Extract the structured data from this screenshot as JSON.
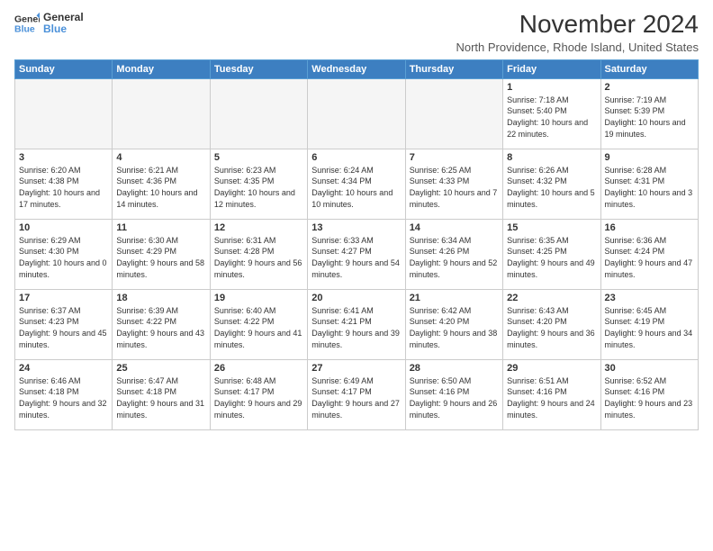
{
  "header": {
    "logo_line1": "General",
    "logo_line2": "Blue",
    "month_title": "November 2024",
    "subtitle": "North Providence, Rhode Island, United States"
  },
  "days_of_week": [
    "Sunday",
    "Monday",
    "Tuesday",
    "Wednesday",
    "Thursday",
    "Friday",
    "Saturday"
  ],
  "weeks": [
    [
      {
        "day": "",
        "info": ""
      },
      {
        "day": "",
        "info": ""
      },
      {
        "day": "",
        "info": ""
      },
      {
        "day": "",
        "info": ""
      },
      {
        "day": "",
        "info": ""
      },
      {
        "day": "1",
        "info": "Sunrise: 7:18 AM\nSunset: 5:40 PM\nDaylight: 10 hours and 22 minutes."
      },
      {
        "day": "2",
        "info": "Sunrise: 7:19 AM\nSunset: 5:39 PM\nDaylight: 10 hours and 19 minutes."
      }
    ],
    [
      {
        "day": "3",
        "info": "Sunrise: 6:20 AM\nSunset: 4:38 PM\nDaylight: 10 hours and 17 minutes."
      },
      {
        "day": "4",
        "info": "Sunrise: 6:21 AM\nSunset: 4:36 PM\nDaylight: 10 hours and 14 minutes."
      },
      {
        "day": "5",
        "info": "Sunrise: 6:23 AM\nSunset: 4:35 PM\nDaylight: 10 hours and 12 minutes."
      },
      {
        "day": "6",
        "info": "Sunrise: 6:24 AM\nSunset: 4:34 PM\nDaylight: 10 hours and 10 minutes."
      },
      {
        "day": "7",
        "info": "Sunrise: 6:25 AM\nSunset: 4:33 PM\nDaylight: 10 hours and 7 minutes."
      },
      {
        "day": "8",
        "info": "Sunrise: 6:26 AM\nSunset: 4:32 PM\nDaylight: 10 hours and 5 minutes."
      },
      {
        "day": "9",
        "info": "Sunrise: 6:28 AM\nSunset: 4:31 PM\nDaylight: 10 hours and 3 minutes."
      }
    ],
    [
      {
        "day": "10",
        "info": "Sunrise: 6:29 AM\nSunset: 4:30 PM\nDaylight: 10 hours and 0 minutes."
      },
      {
        "day": "11",
        "info": "Sunrise: 6:30 AM\nSunset: 4:29 PM\nDaylight: 9 hours and 58 minutes."
      },
      {
        "day": "12",
        "info": "Sunrise: 6:31 AM\nSunset: 4:28 PM\nDaylight: 9 hours and 56 minutes."
      },
      {
        "day": "13",
        "info": "Sunrise: 6:33 AM\nSunset: 4:27 PM\nDaylight: 9 hours and 54 minutes."
      },
      {
        "day": "14",
        "info": "Sunrise: 6:34 AM\nSunset: 4:26 PM\nDaylight: 9 hours and 52 minutes."
      },
      {
        "day": "15",
        "info": "Sunrise: 6:35 AM\nSunset: 4:25 PM\nDaylight: 9 hours and 49 minutes."
      },
      {
        "day": "16",
        "info": "Sunrise: 6:36 AM\nSunset: 4:24 PM\nDaylight: 9 hours and 47 minutes."
      }
    ],
    [
      {
        "day": "17",
        "info": "Sunrise: 6:37 AM\nSunset: 4:23 PM\nDaylight: 9 hours and 45 minutes."
      },
      {
        "day": "18",
        "info": "Sunrise: 6:39 AM\nSunset: 4:22 PM\nDaylight: 9 hours and 43 minutes."
      },
      {
        "day": "19",
        "info": "Sunrise: 6:40 AM\nSunset: 4:22 PM\nDaylight: 9 hours and 41 minutes."
      },
      {
        "day": "20",
        "info": "Sunrise: 6:41 AM\nSunset: 4:21 PM\nDaylight: 9 hours and 39 minutes."
      },
      {
        "day": "21",
        "info": "Sunrise: 6:42 AM\nSunset: 4:20 PM\nDaylight: 9 hours and 38 minutes."
      },
      {
        "day": "22",
        "info": "Sunrise: 6:43 AM\nSunset: 4:20 PM\nDaylight: 9 hours and 36 minutes."
      },
      {
        "day": "23",
        "info": "Sunrise: 6:45 AM\nSunset: 4:19 PM\nDaylight: 9 hours and 34 minutes."
      }
    ],
    [
      {
        "day": "24",
        "info": "Sunrise: 6:46 AM\nSunset: 4:18 PM\nDaylight: 9 hours and 32 minutes."
      },
      {
        "day": "25",
        "info": "Sunrise: 6:47 AM\nSunset: 4:18 PM\nDaylight: 9 hours and 31 minutes."
      },
      {
        "day": "26",
        "info": "Sunrise: 6:48 AM\nSunset: 4:17 PM\nDaylight: 9 hours and 29 minutes."
      },
      {
        "day": "27",
        "info": "Sunrise: 6:49 AM\nSunset: 4:17 PM\nDaylight: 9 hours and 27 minutes."
      },
      {
        "day": "28",
        "info": "Sunrise: 6:50 AM\nSunset: 4:16 PM\nDaylight: 9 hours and 26 minutes."
      },
      {
        "day": "29",
        "info": "Sunrise: 6:51 AM\nSunset: 4:16 PM\nDaylight: 9 hours and 24 minutes."
      },
      {
        "day": "30",
        "info": "Sunrise: 6:52 AM\nSunset: 4:16 PM\nDaylight: 9 hours and 23 minutes."
      }
    ]
  ]
}
